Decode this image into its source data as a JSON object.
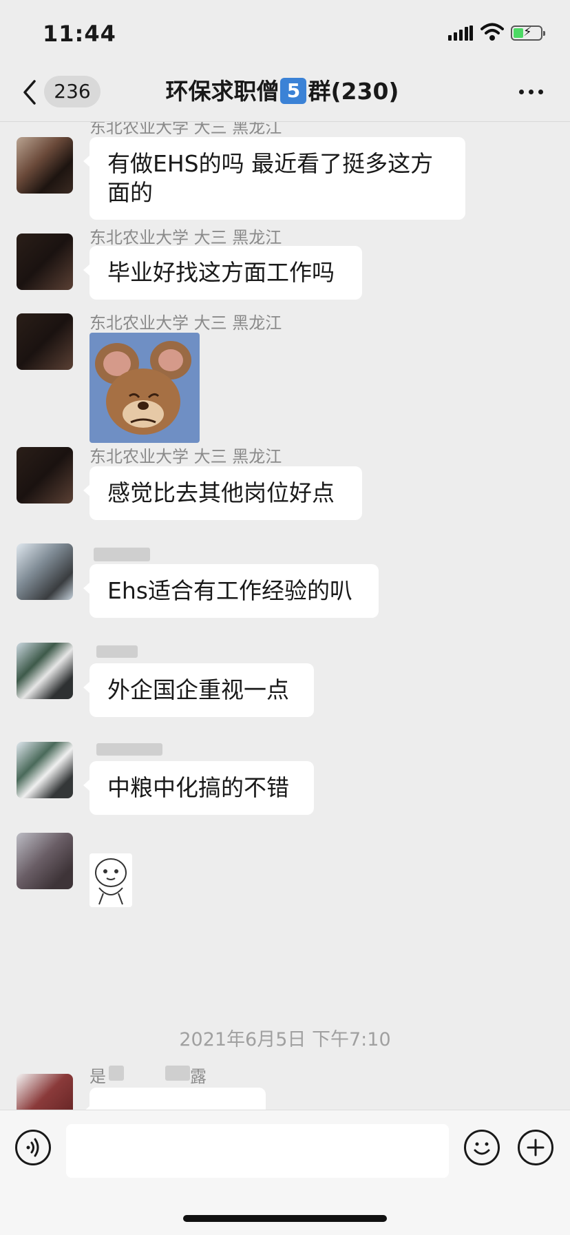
{
  "status_bar": {
    "time": "11:44",
    "icons": [
      "signal-icon",
      "wifi-icon",
      "battery-charging-icon"
    ]
  },
  "nav": {
    "back_icon": "chevron-left-icon",
    "unread_count": "236",
    "title_prefix": "环保求职僧",
    "title_badge": "5",
    "title_suffix": "群(230)",
    "more_icon": "more-dots-icon"
  },
  "messages": [
    {
      "sender": "东北农业大学 大三 黑龙江",
      "type": "text",
      "text": "有做EHS的吗 最近看了挺多这方面的"
    },
    {
      "sender": "东北农业大学 大三 黑龙江",
      "type": "text",
      "text": "毕业好找这方面工作吗"
    },
    {
      "sender": "东北农业大学 大三 黑龙江",
      "type": "sticker",
      "sticker": "crying-mouse-sticker"
    },
    {
      "sender": "东北农业大学 大三 黑龙江",
      "type": "text",
      "text": "感觉比去其他岗位好点"
    },
    {
      "sender": "",
      "type": "text",
      "text": "Ehs适合有工作经验的叭"
    },
    {
      "sender": "",
      "type": "text",
      "text": "外企国企重视一点"
    },
    {
      "sender": "",
      "type": "text",
      "text": "中粮中化搞的不错"
    },
    {
      "sender": "",
      "type": "sticker",
      "sticker": "cartoon-face-sticker"
    },
    {
      "sender_first": "是",
      "sender_last": "露",
      "type": "text",
      "text": ""
    }
  ],
  "timestamp": "2021年6月5日 下午7:10",
  "input_bar": {
    "voice_icon": "voice-icon",
    "input_value": "",
    "emoji_icon": "emoji-icon",
    "plus_icon": "plus-icon"
  },
  "colors": {
    "background": "#ededed",
    "bubble": "#ffffff",
    "sender_text": "#8a8a8a",
    "badge_blue": "#3b82d6"
  }
}
